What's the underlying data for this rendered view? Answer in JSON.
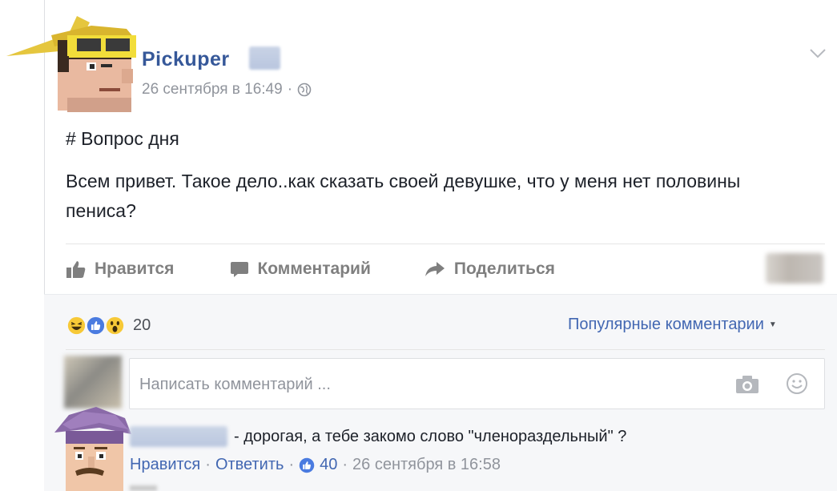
{
  "post": {
    "author": "Pickuper",
    "date": "26 сентября в 16:49",
    "separator": "·",
    "hashtag": "# Вопрос дня",
    "text": "Всем привет. Такое дело..как сказать своей девушке, что у меня нет половины пениса?"
  },
  "actions": {
    "like": "Нравится",
    "comment": "Комментарий",
    "share": "Поделиться"
  },
  "reactions": {
    "icons": [
      "haha-icon",
      "like-icon",
      "wow-icon"
    ],
    "count": "20"
  },
  "sort": {
    "label": "Популярные комментарии",
    "caret": "▼"
  },
  "comment_box": {
    "placeholder": "Написать комментарий ..."
  },
  "comment": {
    "text": "- дорогая, а тебе закомо слово \"членораздельный\" ?",
    "like_link": "Нравится",
    "reply_link": "Ответить",
    "separator": "·",
    "likes": "40",
    "date": "26 сентября в 16:58"
  },
  "colors": {
    "link_blue": "#365899",
    "action_gray": "#7f7f7f",
    "meta_gray": "#90949c",
    "fb_blue": "#4267b2"
  }
}
